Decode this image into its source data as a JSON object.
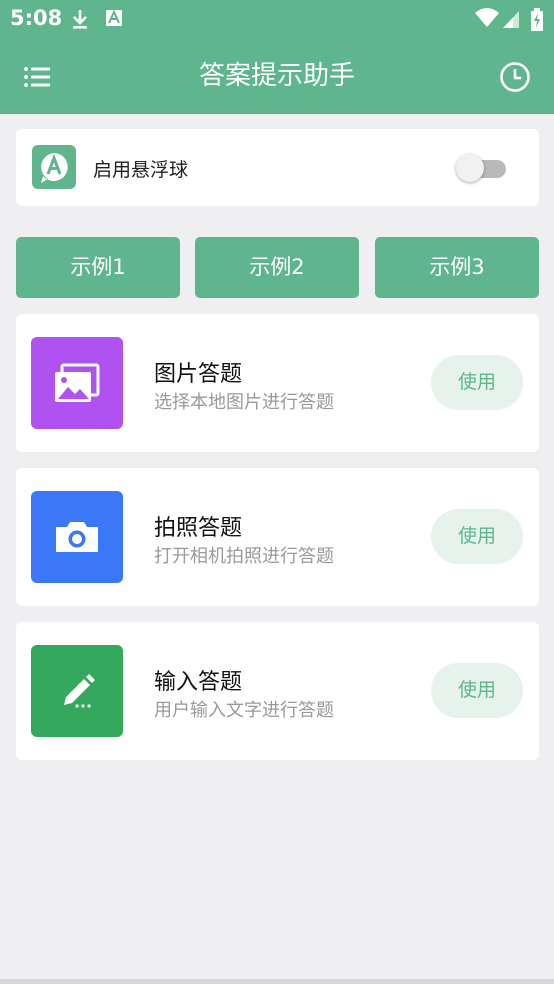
{
  "status_bar": {
    "time": "5:08",
    "icons": [
      "download-icon",
      "a-badge-icon",
      "wifi-icon",
      "cellular-icon",
      "battery-charging-icon"
    ]
  },
  "app_bar": {
    "title": "答案提示助手",
    "left_icon": "menu-list-icon",
    "right_icon": "history-clock-icon"
  },
  "floating_ball": {
    "label": "启用悬浮球",
    "logo_letter": "A",
    "enabled": false
  },
  "examples": [
    "示例1",
    "示例2",
    "示例3"
  ],
  "features": [
    {
      "title": "图片答题",
      "description": "选择本地图片进行答题",
      "button": "使用",
      "icon": "image-gallery-icon",
      "color": "#b052f0"
    },
    {
      "title": "拍照答题",
      "description": "打开相机拍照进行答题",
      "button": "使用",
      "icon": "camera-icon",
      "color": "#3b78f7"
    },
    {
      "title": "输入答题",
      "description": "用户输入文字进行答题",
      "button": "使用",
      "icon": "pencil-icon",
      "color": "#34a85c"
    }
  ],
  "colors": {
    "primary": "#60b68c",
    "background": "#efeff2",
    "use_button_bg": "#e6f2ec"
  }
}
